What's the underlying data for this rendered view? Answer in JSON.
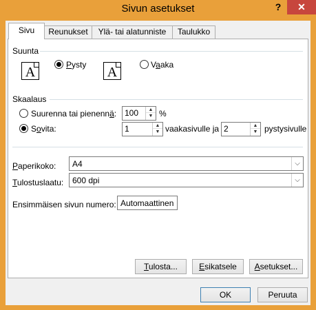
{
  "window": {
    "title": "Sivun asetukset",
    "help_label": "?",
    "close_label": "✕",
    "accent_color": "#e9a03a",
    "close_color": "#c7463d"
  },
  "tabs": [
    {
      "label": "Sivu",
      "active": true
    },
    {
      "label": "Reunukset",
      "active": false
    },
    {
      "label": "Ylä- tai alatunniste",
      "active": false
    },
    {
      "label": "Taulukko",
      "active": false
    }
  ],
  "orientation": {
    "group_label": "Suunta",
    "portrait": {
      "prefix": "",
      "mnemonic": "P",
      "rest": "ysty",
      "selected": true,
      "icon_glyph": "A"
    },
    "landscape": {
      "prefix": "V",
      "mnemonic": "a",
      "rest": "aka",
      "selected": false,
      "icon_glyph": "A"
    }
  },
  "scaling": {
    "group_label": "Skaalaus",
    "adjust": {
      "prefix": "Suurenna tai pienenn",
      "mnemonic": "ä",
      "rest": ":",
      "value": "100",
      "unit": "%",
      "selected": false
    },
    "fit": {
      "prefix": "S",
      "mnemonic": "o",
      "rest": "vita:",
      "pages_wide": "1",
      "wide_label": "vaakasivulle ja",
      "pages_tall": "2",
      "tall_label": "pystysivulle",
      "selected": true
    }
  },
  "paper_size": {
    "prefix": "",
    "mnemonic": "P",
    "rest": "aperikoko:",
    "value": "A4"
  },
  "print_quality": {
    "prefix": "",
    "mnemonic": "T",
    "rest": "ulostuslaatu:",
    "value": "600 dpi"
  },
  "first_page_number": {
    "label": "Ensimmäisen sivun numero:",
    "value": "Automaattinen"
  },
  "panel_buttons": {
    "print": {
      "prefix": "",
      "mnemonic": "T",
      "rest": "ulosta..."
    },
    "preview": {
      "prefix": "",
      "mnemonic": "E",
      "rest": "sikatsele"
    },
    "options": {
      "prefix": "",
      "mnemonic": "A",
      "rest": "setukset..."
    }
  },
  "dialog_buttons": {
    "ok": "OK",
    "cancel": "Peruuta"
  }
}
